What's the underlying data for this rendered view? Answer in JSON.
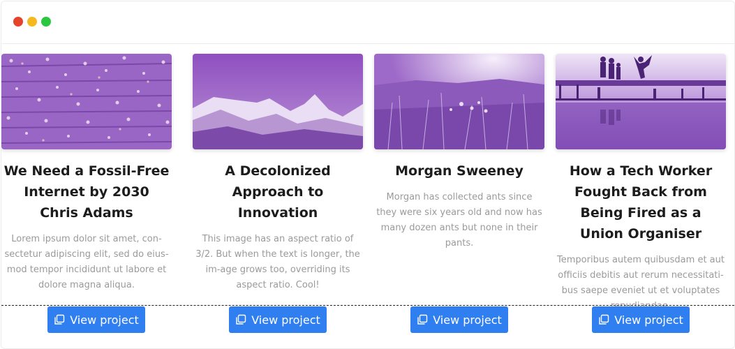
{
  "window": {
    "controls": [
      "close",
      "minimize",
      "maximize"
    ]
  },
  "cards": [
    {
      "title": "A Decolonized Approach to Innovation",
      "description": "This image has an aspect ratio of 3/2. But when the text is longer, the im-age grows too, overriding its aspect ratio. Cool!",
      "image": "mountains",
      "button_label": "View project",
      "button_icon": "copy-icon"
    },
    {
      "title": "Morgan Sweeney",
      "description": "Morgan has collected ants since they were six years old and now has many dozen ants but none in their pants.",
      "image": "meadow",
      "button_label": "View project",
      "button_icon": "copy-icon"
    },
    {
      "title": "How a Tech Worker Fought Back from Being Fired as a Union Organiser",
      "description": "Temporibus autem quibusdam et aut officiis debitis aut rerum necessitati-bus saepe eveniet ut et voluptates repudiandae.",
      "image": "lake-jump",
      "button_label": "View project",
      "button_icon": "copy-icon"
    },
    {
      "title": "We Need a Fossil-Free Internet by 2030 Chris Adams",
      "description": "Lorem ipsum dolor sit amet, con-sectetur adipiscing elit, sed do eius-mod tempor incididunt ut labore et dolore magna aliqua.",
      "image": "wood-flowers",
      "button_label": "View project",
      "button_icon": "copy-icon"
    }
  ],
  "colors": {
    "button": "#2f7ff0",
    "image_tint": "#8a55b8",
    "title": "#1c1c1c",
    "description": "#9a9a9a"
  }
}
